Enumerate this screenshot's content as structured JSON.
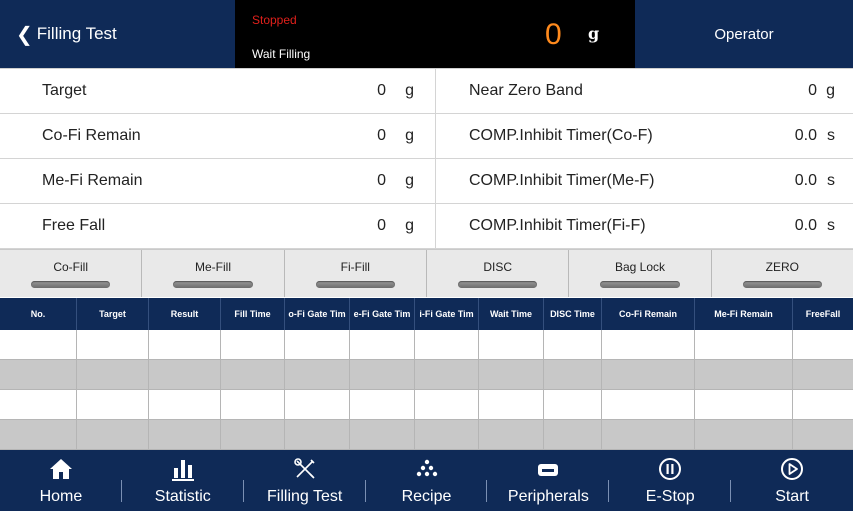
{
  "header": {
    "back_label": "Filling Test",
    "status_text": "Stopped",
    "state_text": "Wait Filling",
    "weight_value": "0",
    "weight_unit": "g",
    "operator_label": "Operator"
  },
  "params": [
    {
      "left": {
        "label": "Target",
        "value": "0",
        "unit": "g"
      },
      "right": {
        "label": "Near Zero Band",
        "value": "0",
        "unit": "g"
      }
    },
    {
      "left": {
        "label": "Co-Fi Remain",
        "value": "0",
        "unit": "g"
      },
      "right": {
        "label": "COMP.Inhibit Timer(Co-F)",
        "value": "0.0",
        "unit": "s"
      }
    },
    {
      "left": {
        "label": "Me-Fi Remain",
        "value": "0",
        "unit": "g"
      },
      "right": {
        "label": "COMP.Inhibit Timer(Me-F)",
        "value": "0.0",
        "unit": "s"
      }
    },
    {
      "left": {
        "label": "Free Fall",
        "value": "0",
        "unit": "g"
      },
      "right": {
        "label": "COMP.Inhibit Timer(Fi-F)",
        "value": "0.0",
        "unit": "s"
      }
    }
  ],
  "indicators": [
    "Co-Fill",
    "Me-Fill",
    "Fi-Fill",
    "DISC",
    "Bag Lock",
    "ZERO"
  ],
  "table": {
    "columns": [
      "No.",
      "Target",
      "Result",
      "Fill Time",
      "o-Fi Gate Tim",
      "e-Fi Gate Tim",
      "i-Fi Gate Tim",
      "Wait Time",
      "DISC Time",
      "Co-Fi Remain",
      "Me-Fi Remain",
      "FreeFall"
    ],
    "rows": [
      [
        "",
        "",
        "",
        "",
        "",
        "",
        "",
        "",
        "",
        "",
        "",
        ""
      ],
      [
        "",
        "",
        "",
        "",
        "",
        "",
        "",
        "",
        "",
        "",
        "",
        ""
      ],
      [
        "",
        "",
        "",
        "",
        "",
        "",
        "",
        "",
        "",
        "",
        "",
        ""
      ],
      [
        "",
        "",
        "",
        "",
        "",
        "",
        "",
        "",
        "",
        "",
        "",
        ""
      ]
    ]
  },
  "nav": [
    {
      "label": "Home",
      "icon": "home-icon"
    },
    {
      "label": "Statistic",
      "icon": "bar-chart-icon"
    },
    {
      "label": "Filling Test",
      "icon": "tools-icon"
    },
    {
      "label": "Recipe",
      "icon": "dots-pyramid-icon"
    },
    {
      "label": "Peripherals",
      "icon": "printer-icon"
    },
    {
      "label": "E-Stop",
      "icon": "pause-circle-icon"
    },
    {
      "label": "Start",
      "icon": "play-circle-icon"
    }
  ],
  "colors": {
    "navy": "#0f2a57",
    "status_red": "#e0201b",
    "weight_orange": "#ff8a1d"
  }
}
